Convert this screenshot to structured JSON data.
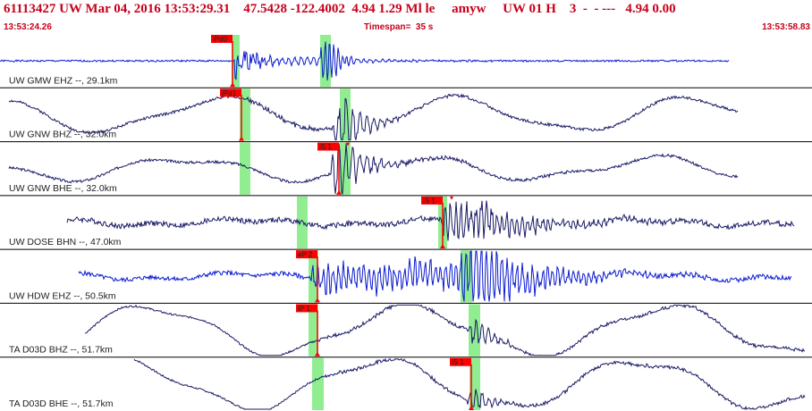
{
  "header": {
    "title": "61113427 UW Mar 04, 2016 13:53:29.31    47.5428 -122.4002  4.94 1.29 Ml le     amyw     UW 01 H    3  -  - ---   4.94 0.00",
    "start_time": "13:53:24.26",
    "timespan": "Timespan=  35 s",
    "end_time": "13:53:58.83"
  },
  "colors": {
    "accent": "#c8001a",
    "trace": "#1a1a66",
    "trace_bright": "#0a1ad0",
    "window": "#90ee90",
    "pick": "#ff0000"
  },
  "traces": [
    {
      "label": "UW GMW EHZ --, 29.1km",
      "pick": {
        "text": "iPd0"
      }
    },
    {
      "label": "UW GNW BHZ --, 32.0km",
      "pick": {
        "text": "iPd1"
      }
    },
    {
      "label": "UW GNW BHE --, 32.0km",
      "pick": {
        "text": "iS 1"
      }
    },
    {
      "label": "UW DOSE BHN --, 47.0km",
      "pick": {
        "text": "iS 1"
      }
    },
    {
      "label": "UW HDW EHZ --, 50.5km",
      "pick": {
        "text": "eP 2"
      }
    },
    {
      "label": "TA D03D BHZ --, 51.7km",
      "pick": {
        "text": "iP 1"
      }
    },
    {
      "label": "TA D03D BHE --, 51.7km",
      "pick": {
        "text": "iS 1"
      }
    }
  ]
}
